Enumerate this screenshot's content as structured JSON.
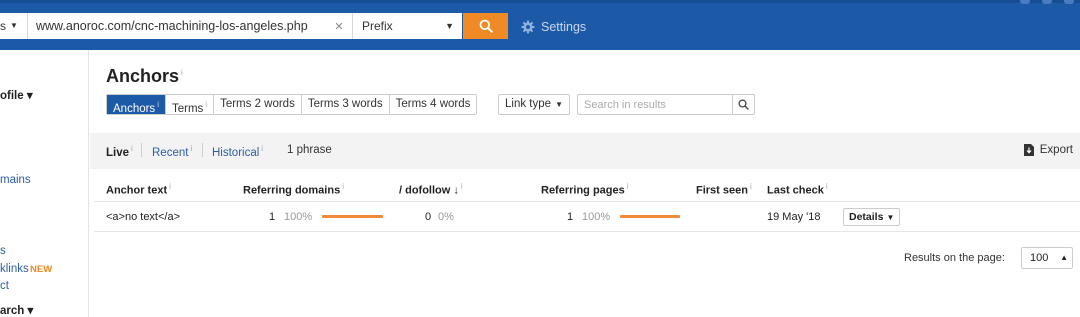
{
  "topbar": {
    "mode_label": "s",
    "url_value": "www.anoroc.com/cnc-machining-los-angeles.php",
    "clear_glyph": "×",
    "prefix_value": "Prefix",
    "settings_label": "Settings",
    "icons": {
      "clear": "close-icon",
      "search": "search-icon",
      "settings": "gear-icon"
    },
    "colors": {
      "bar": "#1c5aa8",
      "search_button": "#f08a24"
    }
  },
  "sidebar": {
    "items": [
      {
        "label": "ofile ▾"
      },
      {
        "label": "mains"
      },
      {
        "label": "s"
      },
      {
        "label": "klinks"
      },
      {
        "label": "ct"
      },
      {
        "label": "arch ▾"
      }
    ],
    "new_badge": "NEW"
  },
  "main": {
    "title": "Anchors",
    "info_glyph": "i",
    "tabs": [
      "Anchors",
      "Terms",
      "Terms 2 words",
      "Terms 3 words",
      "Terms 4 words"
    ],
    "link_type": "Link type",
    "search_placeholder": "Search in results",
    "filters": {
      "live": "Live",
      "recent": "Recent",
      "historical": "Historical",
      "count": "1 phrase"
    },
    "export_label": "Export",
    "columns": [
      "Anchor text",
      "Referring domains",
      "/ dofollow",
      "Referring pages",
      "First seen",
      "Last check"
    ],
    "dofollow_arrow": "↓",
    "rows": [
      {
        "anchor": "<a>no text</a>",
        "referring_domains": "1",
        "referring_domains_pct": "100%",
        "dofollow": "0",
        "dofollow_pct": "0%",
        "referring_pages": "1",
        "referring_pages_pct": "100%",
        "first_seen": "",
        "last_check": "19 May '18",
        "details": "Details"
      }
    ],
    "pct_values": {
      "referring_domains": 1.0,
      "referring_pages": 1.0
    },
    "results_label": "Results on the page:",
    "results_value": "100",
    "colors": {
      "active_tab": "#1c5aa8",
      "bar": "#ee8a3a",
      "link": "#2c5ea8"
    }
  }
}
